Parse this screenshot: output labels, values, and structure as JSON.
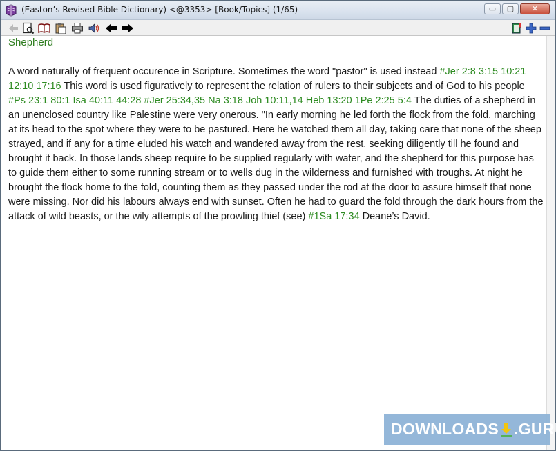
{
  "window": {
    "title": "(Easton’s Revised Bible Dictionary) <@3353> [Book/Topics] (1/65)",
    "controls": {
      "minimize": "▭",
      "maximize": "▢",
      "close": "✕"
    }
  },
  "toolbar": {
    "left_icons": [
      "back-arrow-icon",
      "preview-icon",
      "open-book-icon",
      "clipboard-icon",
      "print-icon",
      "speaker-icon",
      "prev-arrow-icon",
      "next-arrow-icon"
    ],
    "right_icons": [
      "bookmark-icon",
      "zoom-in-icon",
      "zoom-out-icon"
    ]
  },
  "entry": {
    "heading": "Shepherd",
    "p1": "A word naturally of frequent occurence in Scripture. Sometimes the word \"pastor\" is used instead ",
    "ref1": "#Jer 2:8 3:15 10:21 12:10 17:16",
    "p2": " This word is used figuratively to represent the relation of rulers to their subjects and of God to his people ",
    "ref2": "#Ps 23:1 80:1 Isa 40:11 44:28 #Jer 25:34,35 Na 3:18 Joh 10:11,14 Heb 13:20 1Pe 2:25 5:4",
    "p3": " The duties of a shepherd in an unenclosed country like Palestine were very onerous. \"In early morning he led forth the flock from the fold, marching at its head to the spot where they were to be pastured. Here he watched them all day, taking care that none of the sheep strayed, and if any for a time eluded his watch and wandered away from the rest, seeking diligently till he found and brought it back. In those lands sheep require to be supplied regularly with water, and the shepherd for this purpose has to guide them either to some running stream or to wells dug in the wilderness and furnished with troughs. At night he brought the flock home to the fold, counting them as they passed under the rod at the door to assure himself that none were missing. Nor did his labours always end with sunset. Often he had to guard the fold through the dark hours from the attack of wild beasts, or the wily attempts of the prowling thief (see) ",
    "ref3": "#1Sa 17:34",
    "p4": " Deane’s David."
  },
  "watermark": {
    "left": "DOWNLOADS",
    "right": ".GURU"
  },
  "colors": {
    "reference": "#2e8b22",
    "heading": "#2e7d1f",
    "watermark": "#8fb4d7"
  }
}
